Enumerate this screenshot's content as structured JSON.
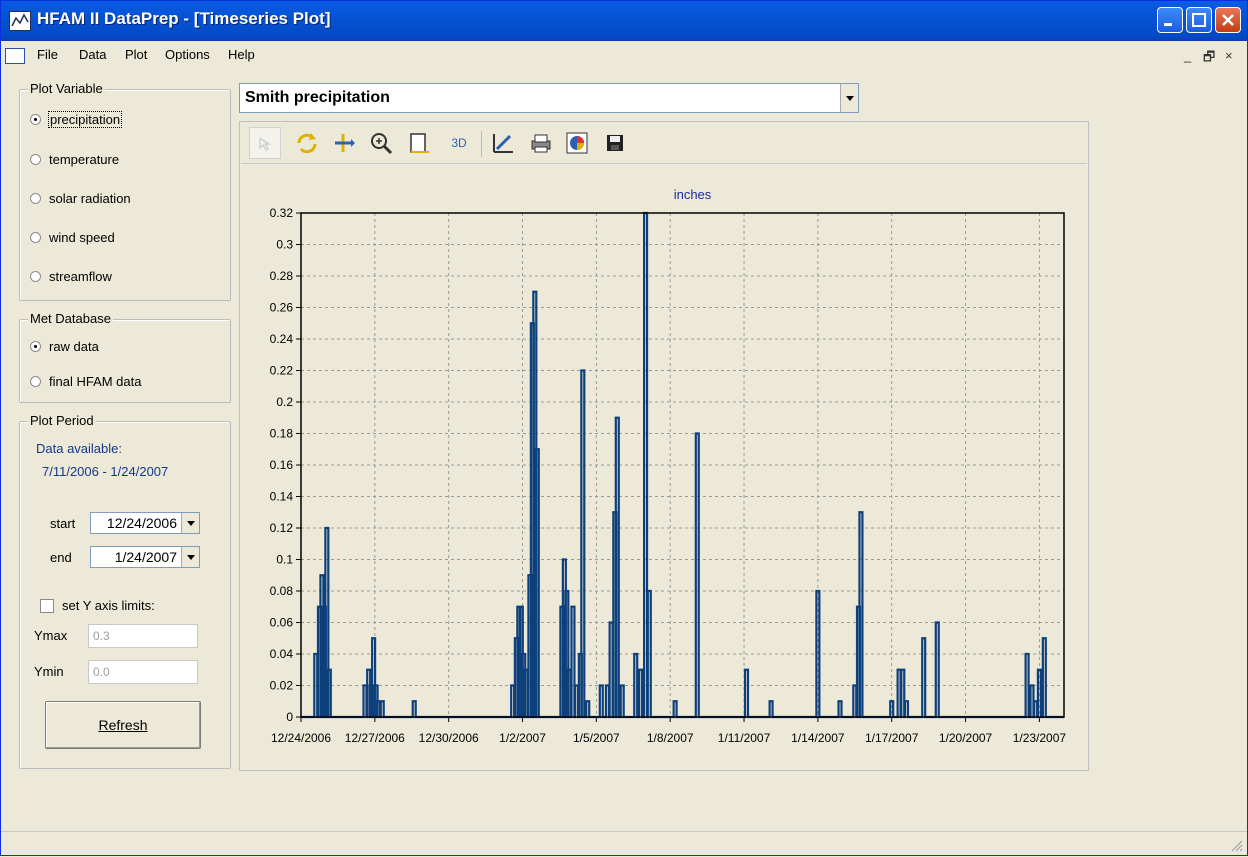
{
  "window": {
    "title": "HFAM II DataPrep - [Timeseries Plot]"
  },
  "menu": [
    "File",
    "Data",
    "Plot",
    "Options",
    "Help"
  ],
  "mdi_controls": [
    "_",
    "🗗",
    "×"
  ],
  "plot_variable": {
    "legend": "Plot Variable",
    "options": [
      "precipitation",
      "temperature",
      "solar radiation",
      "wind speed",
      "streamflow"
    ],
    "selected": "precipitation"
  },
  "met_database": {
    "legend": "Met Database",
    "options": [
      "raw data",
      "final HFAM data"
    ],
    "selected": "raw data"
  },
  "plot_period": {
    "legend": "Plot Period",
    "available_label": "Data available:",
    "available_range": "7/11/2006 - 1/24/2007",
    "start_label": "start",
    "start_value": "12/24/2006",
    "end_label": "end",
    "end_value": "1/24/2007",
    "y_limits_label": "set Y axis limits:",
    "ymax_label": "Ymax",
    "ymax_value": "0.3",
    "ymin_label": "Ymin",
    "ymin_value": "0.0"
  },
  "refresh_label": "Refresh",
  "series_selector": {
    "value": "Smith precipitation"
  },
  "toolbar": {
    "icons": [
      "pointer-icon",
      "rotate-icon",
      "move-icon",
      "zoom-icon",
      "frame-icon",
      "3d-icon",
      "edit-icon",
      "print-icon",
      "chart-icon",
      "save-icon"
    ],
    "text_3d": "3D"
  },
  "colors": {
    "series": "#0d3f7a",
    "title_bar": "#0a5ae6"
  },
  "chart_data": {
    "type": "line",
    "title": "inches",
    "xlabel": "",
    "ylabel": "",
    "x_range": [
      0,
      31
    ],
    "ylim": [
      0,
      0.32
    ],
    "y_ticks": [
      0,
      0.02,
      0.04,
      0.06,
      0.08,
      0.1,
      0.12,
      0.14,
      0.16,
      0.18,
      0.2,
      0.22,
      0.24,
      0.26,
      0.28,
      0.3,
      0.32
    ],
    "y_tick_labels": [
      "0",
      "0.02",
      "0.04",
      "0.06",
      "0.08",
      "0.1",
      "0.12",
      "0.14",
      "0.16",
      "0.18",
      "0.2",
      "0.22",
      "0.24",
      "0.26",
      "0.28",
      "0.3",
      "0.32"
    ],
    "x_tick_labels": [
      "12/24/2006",
      "12/27/2006",
      "12/30/2006",
      "1/2/2007",
      "1/5/2007",
      "1/8/2007",
      "1/11/2007",
      "1/14/2007",
      "1/17/2007",
      "1/20/2007",
      "1/23/2007"
    ],
    "x_tick_days": [
      0,
      3,
      6,
      9,
      12,
      15,
      18,
      21,
      24,
      27,
      30
    ],
    "grid": true,
    "series": [
      {
        "values": [
          [
            0.6,
            0.04
          ],
          [
            0.75,
            0.07
          ],
          [
            0.85,
            0.09
          ],
          [
            0.95,
            0.07
          ],
          [
            1.05,
            0.12
          ],
          [
            1.15,
            0.03
          ],
          [
            2.6,
            0.02
          ],
          [
            2.75,
            0.03
          ],
          [
            2.85,
            0.02
          ],
          [
            2.95,
            0.05
          ],
          [
            3.05,
            0.02
          ],
          [
            3.15,
            0.01
          ],
          [
            3.3,
            0.01
          ],
          [
            4.6,
            0.01
          ],
          [
            8.6,
            0.02
          ],
          [
            8.75,
            0.05
          ],
          [
            8.85,
            0.07
          ],
          [
            8.95,
            0.07
          ],
          [
            9.05,
            0.04
          ],
          [
            9.15,
            0.03
          ],
          [
            9.3,
            0.09
          ],
          [
            9.4,
            0.25
          ],
          [
            9.5,
            0.27
          ],
          [
            9.6,
            0.17
          ],
          [
            10.6,
            0.07
          ],
          [
            10.7,
            0.1
          ],
          [
            10.8,
            0.08
          ],
          [
            10.9,
            0.03
          ],
          [
            11.05,
            0.07
          ],
          [
            11.2,
            0.02
          ],
          [
            11.35,
            0.04
          ],
          [
            11.45,
            0.22
          ],
          [
            11.65,
            0.01
          ],
          [
            12.2,
            0.02
          ],
          [
            12.45,
            0.02
          ],
          [
            12.6,
            0.06
          ],
          [
            12.75,
            0.13
          ],
          [
            12.85,
            0.19
          ],
          [
            13.05,
            0.02
          ],
          [
            13.6,
            0.04
          ],
          [
            13.8,
            0.03
          ],
          [
            14.0,
            0.32
          ],
          [
            14.15,
            0.08
          ],
          [
            15.2,
            0.01
          ],
          [
            16.1,
            0.18
          ],
          [
            18.1,
            0.03
          ],
          [
            19.1,
            0.01
          ],
          [
            21.0,
            0.08
          ],
          [
            21.9,
            0.01
          ],
          [
            22.5,
            0.02
          ],
          [
            22.65,
            0.07
          ],
          [
            22.75,
            0.13
          ],
          [
            24.0,
            0.01
          ],
          [
            24.3,
            0.03
          ],
          [
            24.45,
            0.03
          ],
          [
            24.6,
            0.01
          ],
          [
            25.3,
            0.05
          ],
          [
            25.85,
            0.06
          ],
          [
            29.5,
            0.04
          ],
          [
            29.7,
            0.02
          ],
          [
            29.85,
            0.01
          ],
          [
            30.0,
            0.03
          ],
          [
            30.2,
            0.05
          ]
        ]
      }
    ]
  }
}
